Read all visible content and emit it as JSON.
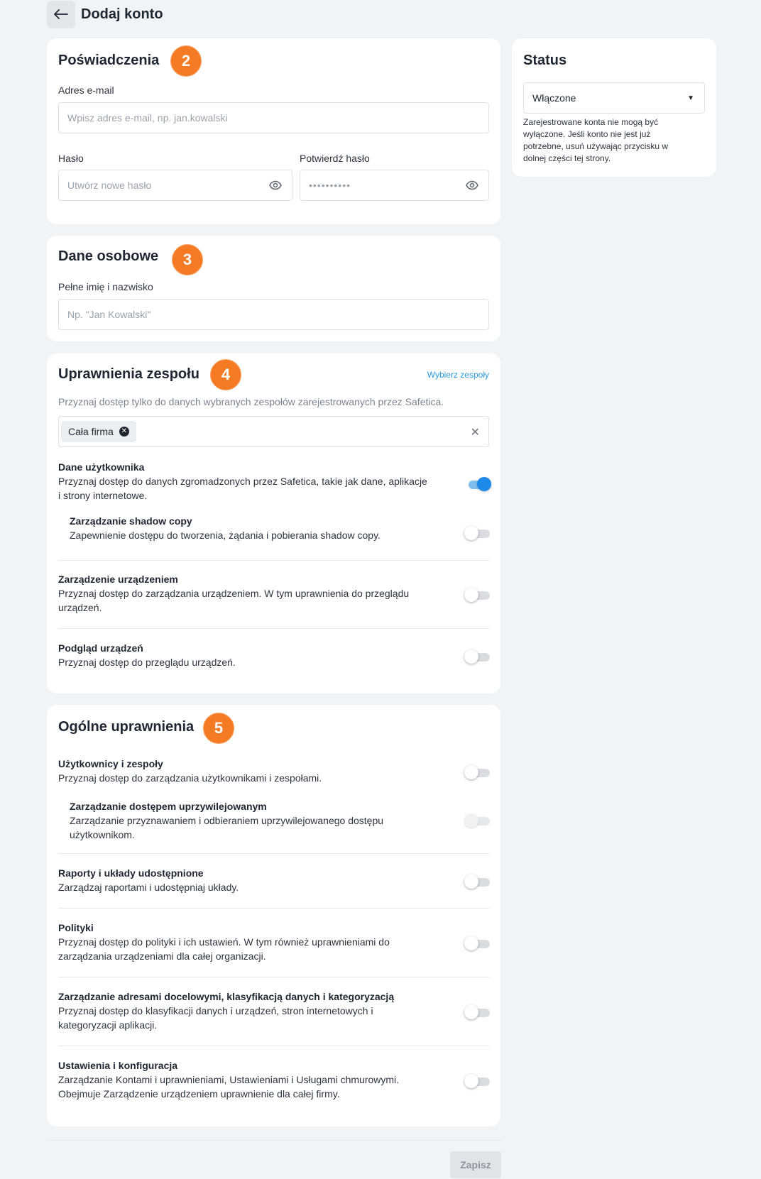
{
  "header": {
    "title": "Dodaj konto",
    "back_icon": "arrow-left-icon"
  },
  "credentials": {
    "title": "Poświadczenia",
    "step": "2",
    "email_label": "Adres e-mail",
    "email_placeholder": "Wpisz adres e-mail, np. jan.kowalski",
    "password_label": "Hasło",
    "password_placeholder": "Utwórz nowe hasło",
    "confirm_label": "Potwierdź hasło",
    "confirm_value": "••••••••••"
  },
  "personal": {
    "title": "Dane osobowe",
    "step": "3",
    "name_label": "Pełne imię i nazwisko",
    "name_placeholder": "Np. \"Jan Kowalski\""
  },
  "team_permissions": {
    "title": "Uprawnienia zespołu",
    "step": "4",
    "select_link": "Wybierz zespoły",
    "subtitle": "Przyznaj dostęp tylko do danych wybranych zespołów zarejestrowanych przez Safetica.",
    "chip": "Cała firma",
    "items": [
      {
        "title": "Dane użytkownika",
        "desc1": "Przyznaj dostęp do danych zgromadzonych przez Safetica, takie jak dane, aplikacje",
        "desc2": "i strony internetowe.",
        "on": true
      },
      {
        "title": "Zarządzanie shadow copy",
        "desc1": "Zapewnienie dostępu do tworzenia, żądania i pobierania shadow copy.",
        "desc2": "",
        "on": false
      },
      {
        "title": "Zarządzenie urządzeniem",
        "desc1": "Przyznaj dostęp do zarządzania urządzeniem. W tym uprawnienia do przeglądu",
        "desc2": "urządzeń.",
        "on": false
      },
      {
        "title": "Podgląd urządzeń",
        "desc1": "Przyznaj dostęp do przeglądu urządzeń.",
        "desc2": "",
        "on": false
      }
    ]
  },
  "general_permissions": {
    "title": "Ogólne uprawnienia",
    "step": "5",
    "items": [
      {
        "title": "Użytkownicy i zespoły",
        "desc1": "Przyznaj dostęp do zarządzania użytkownikami i zespołami.",
        "desc2": "",
        "on": false
      },
      {
        "title": "Zarządzanie dostępem uprzywilejowanym",
        "desc1": "Zarządzanie przyznawaniem i odbieraniem uprzywilejowanego dostępu",
        "desc2": "użytkownikom.",
        "on": false,
        "disabled": true
      },
      {
        "title": "Raporty i układy udostępnione",
        "desc1": "Zarządzaj raportami i udostępniaj układy.",
        "desc2": "",
        "on": false
      },
      {
        "title": "Polityki",
        "desc1": "Przyznaj dostęp do polityki i ich ustawień. W tym również uprawnieniami do",
        "desc2": "zarządzania urządzeniami dla całej organizacji.",
        "on": false
      },
      {
        "title": "Zarządzanie adresami docelowymi, klasyfikacją danych i kategoryzacją",
        "desc1": "Przyznaj dostęp do klasyfikacji danych i urządzeń, stron internetowych i",
        "desc2": "kategoryzacji aplikacji.",
        "on": false
      },
      {
        "title": "Ustawienia i konfiguracja",
        "desc1": "Zarządzanie Kontami i uprawnieniami, Ustawieniami i Usługami chmurowymi.",
        "desc2": "Obejmuje Zarządzenie urządzeniem uprawnienie dla całej firmy.",
        "on": false
      }
    ]
  },
  "status": {
    "title": "Status",
    "selected": "Włączone",
    "help1": "Zarejestrowane konta nie mogą być",
    "help2": "wyłączone. Jeśli konto nie jest już",
    "help3": "potrzebne, usuń używając przycisku w",
    "help4": "dolnej części tej strony."
  },
  "footer": {
    "save_label": "Zapisz"
  },
  "colors": {
    "accent": "#1e8ae8",
    "badge": "#f47b23",
    "background": "#f1f4f7"
  }
}
